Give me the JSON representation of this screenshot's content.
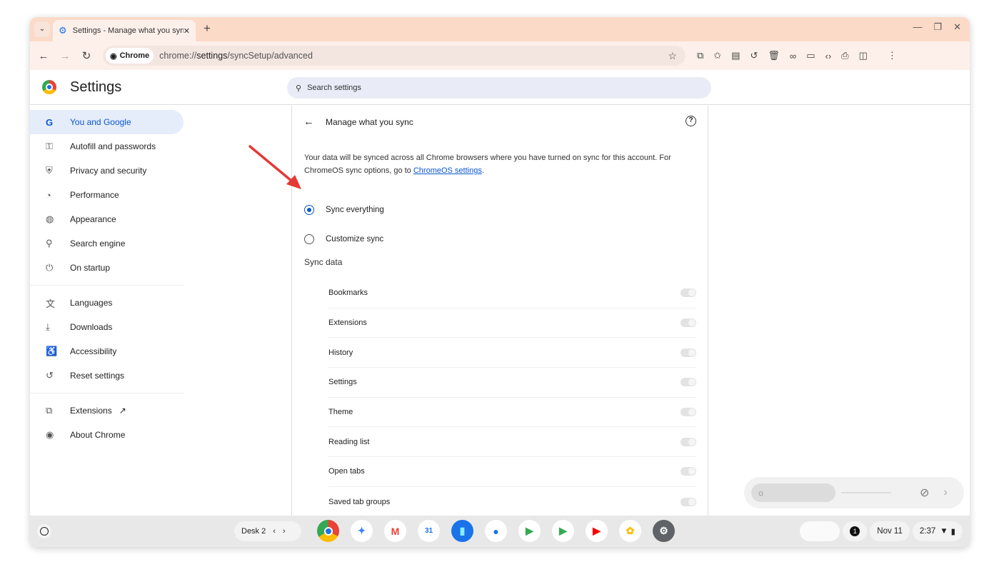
{
  "browser": {
    "tab_title": "Settings - Manage what you sync",
    "url_chip": "Chrome",
    "url_prefix": "chrome://",
    "url_host": "settings",
    "url_path": "/syncSetup/advanced"
  },
  "header": {
    "title": "Settings",
    "search_placeholder": "Search settings"
  },
  "sidebar": {
    "items": [
      {
        "label": "You and Google",
        "icon": "G"
      },
      {
        "label": "Autofill and passwords",
        "icon": "⚿"
      },
      {
        "label": "Privacy and security",
        "icon": "⛨"
      },
      {
        "label": "Performance",
        "icon": "◔"
      },
      {
        "label": "Appearance",
        "icon": "◍"
      },
      {
        "label": "Search engine",
        "icon": "⚲"
      },
      {
        "label": "On startup",
        "icon": "⏻"
      },
      {
        "label": "Languages",
        "icon": "文"
      },
      {
        "label": "Downloads",
        "icon": "⤓"
      },
      {
        "label": "Accessibility",
        "icon": "♿"
      },
      {
        "label": "Reset settings",
        "icon": "↺"
      },
      {
        "label": "Extensions",
        "icon": "⧉"
      },
      {
        "label": "About Chrome",
        "icon": "◉"
      }
    ]
  },
  "main": {
    "title": "Manage what you sync",
    "description": "Your data will be synced across all Chrome browsers where you have turned on sync for this account. For ChromeOS sync options, go to ",
    "link": "ChromeOS settings",
    "desc_end": ".",
    "options": [
      {
        "label": "Sync everything",
        "selected": true
      },
      {
        "label": "Customize sync",
        "selected": false
      }
    ],
    "section": "Sync data",
    "items": [
      "Bookmarks",
      "Extensions",
      "History",
      "Settings",
      "Theme",
      "Reading list",
      "Open tabs",
      "Saved tab groups"
    ]
  },
  "shelf": {
    "desk": "Desk 2",
    "date": "Nov 11",
    "time": "2:37",
    "notifications": "1"
  },
  "colors": {
    "accent": "#0b57d0",
    "tabstrip": "#fbdac8",
    "arrow": "#e53935"
  }
}
